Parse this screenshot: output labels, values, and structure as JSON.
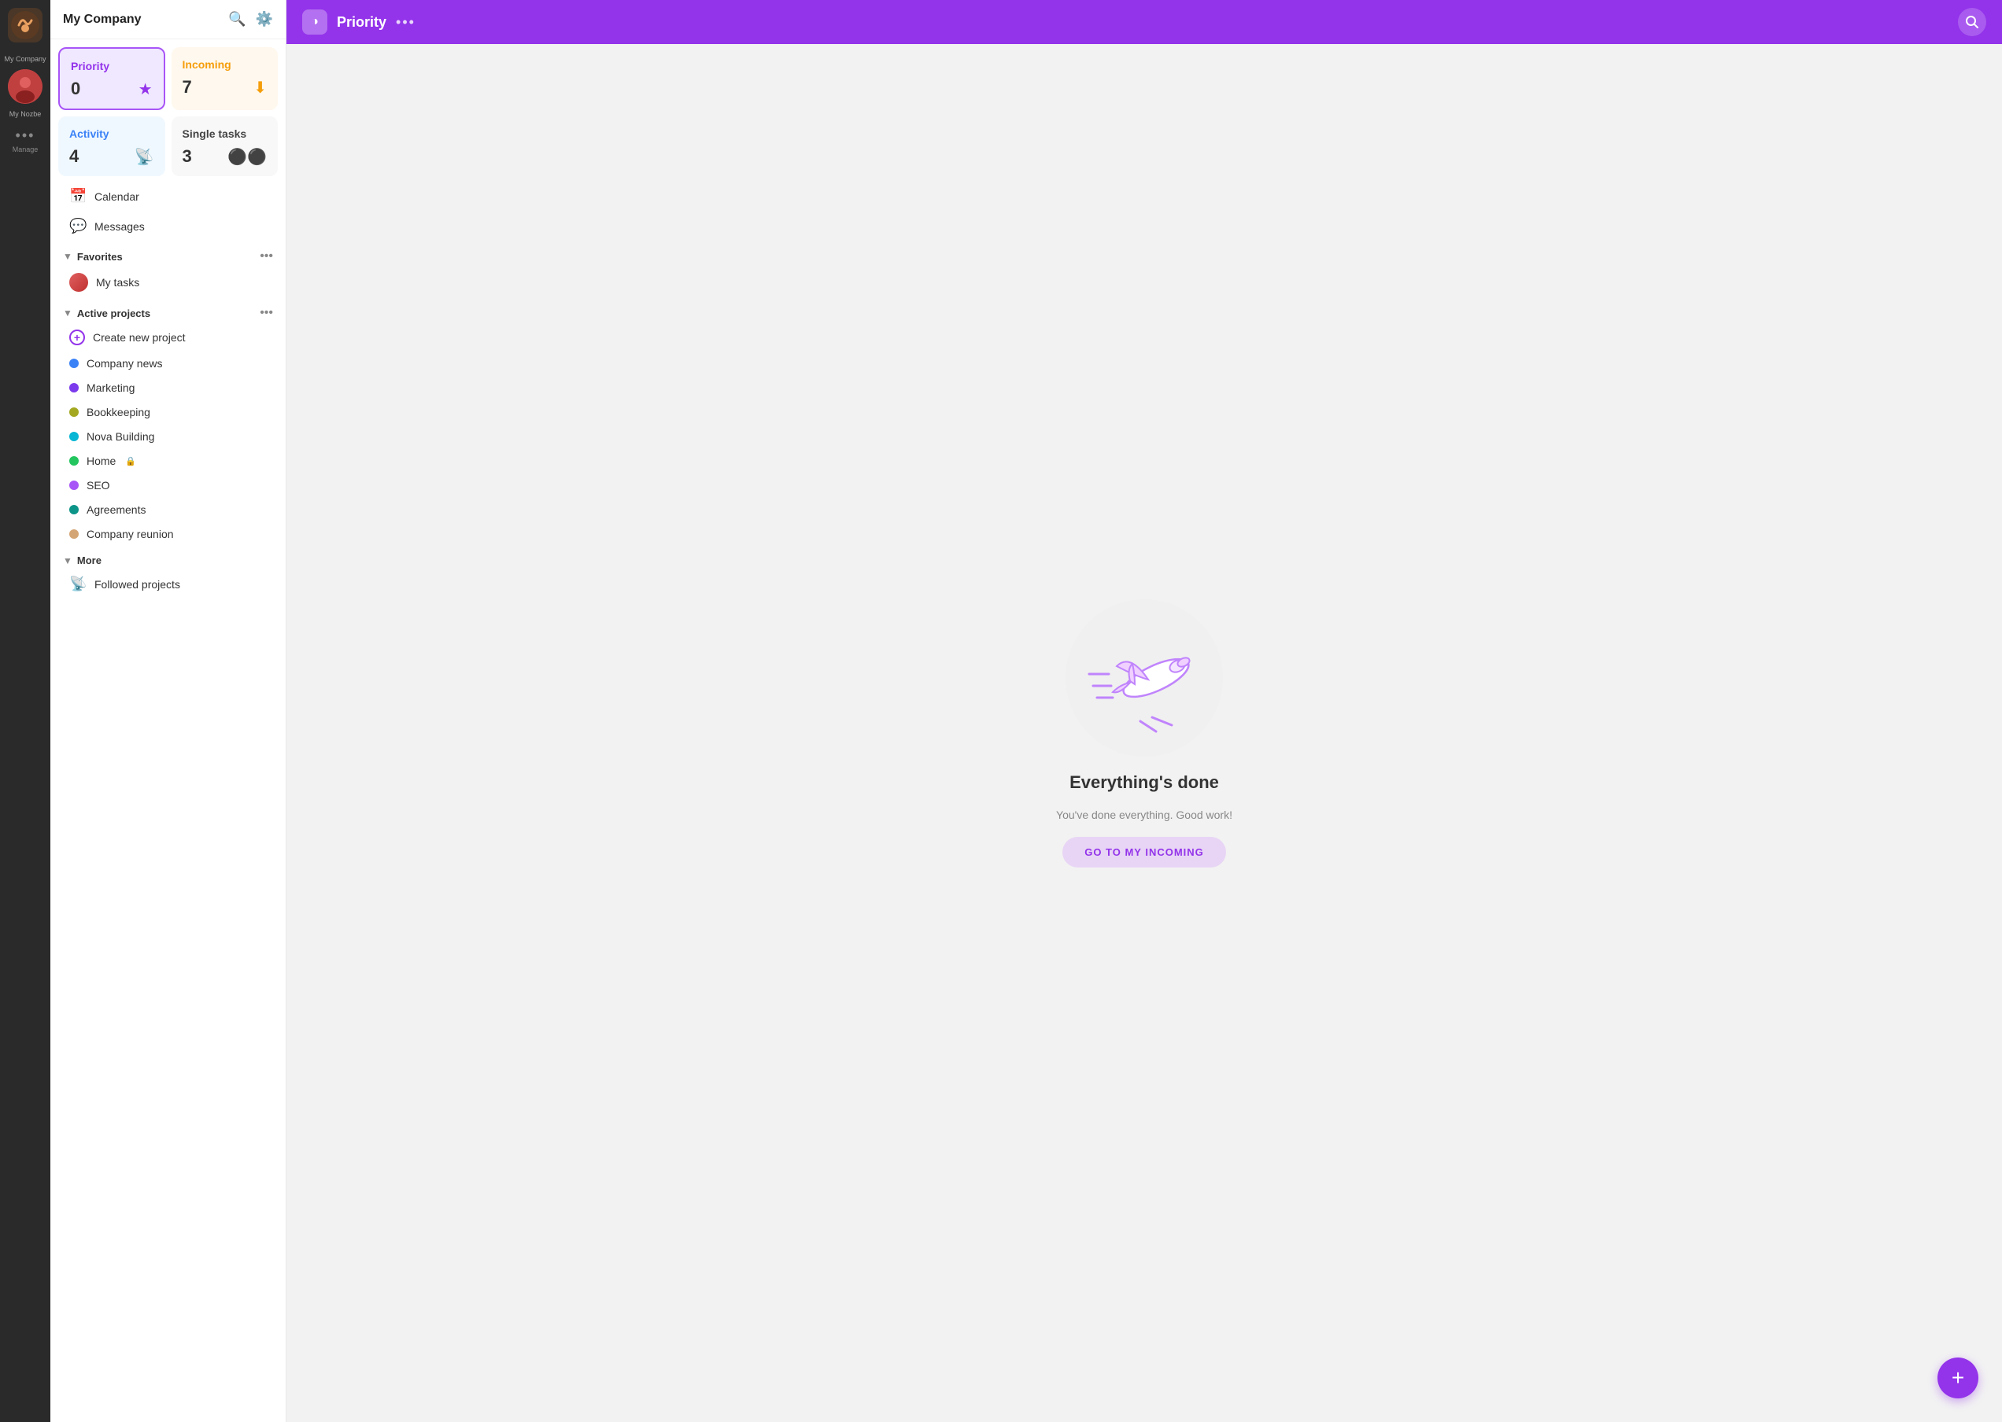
{
  "iconbar": {
    "company_name": "My Company",
    "user_label": "My Nozbe",
    "manage_label": "Manage"
  },
  "sidebar": {
    "title": "My Company",
    "cards": {
      "priority": {
        "title": "Priority",
        "count": "0",
        "icon": "★"
      },
      "incoming": {
        "title": "Incoming",
        "count": "7",
        "icon": "⬇"
      },
      "activity": {
        "title": "Activity",
        "count": "4",
        "icon": "📡"
      },
      "single_tasks": {
        "title": "Single tasks",
        "count": "3",
        "icon": "⚫"
      }
    },
    "nav": {
      "calendar": "Calendar",
      "messages": "Messages"
    },
    "favorites": {
      "section_title": "Favorites",
      "my_tasks": "My tasks"
    },
    "active_projects": {
      "section_title": "Active projects",
      "create_new": "Create new project",
      "projects": [
        {
          "name": "Company news",
          "color": "#3b82f6"
        },
        {
          "name": "Marketing",
          "color": "#7c3aed"
        },
        {
          "name": "Bookkeeping",
          "color": "#a3a820"
        },
        {
          "name": "Nova Building",
          "color": "#06b6d4"
        },
        {
          "name": "Home",
          "color": "#22c55e",
          "locked": true
        },
        {
          "name": "SEO",
          "color": "#a855f7"
        },
        {
          "name": "Agreements",
          "color": "#0d9488"
        },
        {
          "name": "Company reunion",
          "color": "#d4a574"
        }
      ]
    },
    "more": {
      "section_title": "More",
      "followed_projects": "Followed projects"
    }
  },
  "topbar": {
    "title": "Priority",
    "logo_icon": "◑"
  },
  "main": {
    "empty_state": {
      "title": "Everything's done",
      "subtitle": "You've done everything. Good work!",
      "button_label": "GO TO MY INCOMING"
    }
  },
  "fab": {
    "icon": "+"
  }
}
